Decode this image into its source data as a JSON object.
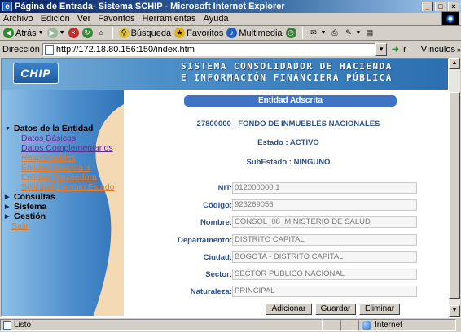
{
  "window": {
    "title": "Página de Entrada- Sistema SCHIP - Microsoft Internet Explorer",
    "min": "_",
    "max": "□",
    "close": "×"
  },
  "menu": [
    "Archivo",
    "Edición",
    "Ver",
    "Favoritos",
    "Herramientas",
    "Ayuda"
  ],
  "toolbar": {
    "back": "Atrás",
    "search": "Búsqueda",
    "favorites": "Favoritos",
    "multimedia": "Multimedia"
  },
  "address": {
    "label": "Dirección",
    "url": "http://172.18.80.156:150/index.htm",
    "go": "Ir",
    "links": "Vínculos"
  },
  "banner": {
    "logo": "CHIP",
    "title_line1": "SISTEMA CONSOLIDADOR DE HACIENDA",
    "title_line2": "E INFORMACIÓN FINANCIERA PÚBLICA"
  },
  "nav": {
    "section1": "Datos de la Entidad",
    "links1": [
      "Datos Básicos",
      "Datos Complementarios",
      "Responsables",
      "Entidad Adscrita a",
      "Entidad Proveedora",
      "Solicitud Cambio Estado"
    ],
    "section2": "Consultas",
    "section3": "Sistema",
    "section4": "Gestión",
    "exit": "Salir"
  },
  "form": {
    "header": "Entidad Adscrita",
    "entity": "27800000 - FONDO DE INMUEBLES NACIONALES",
    "estado": "Estado : ACTIVO",
    "subestado": "SubEstado : NINGUNO",
    "fields": [
      {
        "label": "NIT:",
        "value": "012000000:1"
      },
      {
        "label": "Código:",
        "value": "923269056"
      },
      {
        "label": "Nombre:",
        "value": "CONSOL_08_MINISTERIO DE SALUD"
      },
      {
        "label": "Departamento:",
        "value": "DISTRITO CAPITAL"
      },
      {
        "label": "Ciudad:",
        "value": "BOGOTA - DISTRITO CAPITAL"
      },
      {
        "label": "Sector:",
        "value": "SECTOR PUBLICO NACIONAL"
      },
      {
        "label": "Naturaleza:",
        "value": "PRINCIPAL"
      }
    ],
    "buttons": {
      "add": "Adicionar",
      "save": "Guardar",
      "delete": "Eliminar"
    }
  },
  "status": {
    "text": "Listo",
    "zone": "Internet"
  },
  "colors": {
    "section_pill": "#3d74c6",
    "label_blue": "#2a5190",
    "visited_link": "#5a2f8f",
    "orange_link": "#e07a2a",
    "banner": "#2b6fb0"
  }
}
